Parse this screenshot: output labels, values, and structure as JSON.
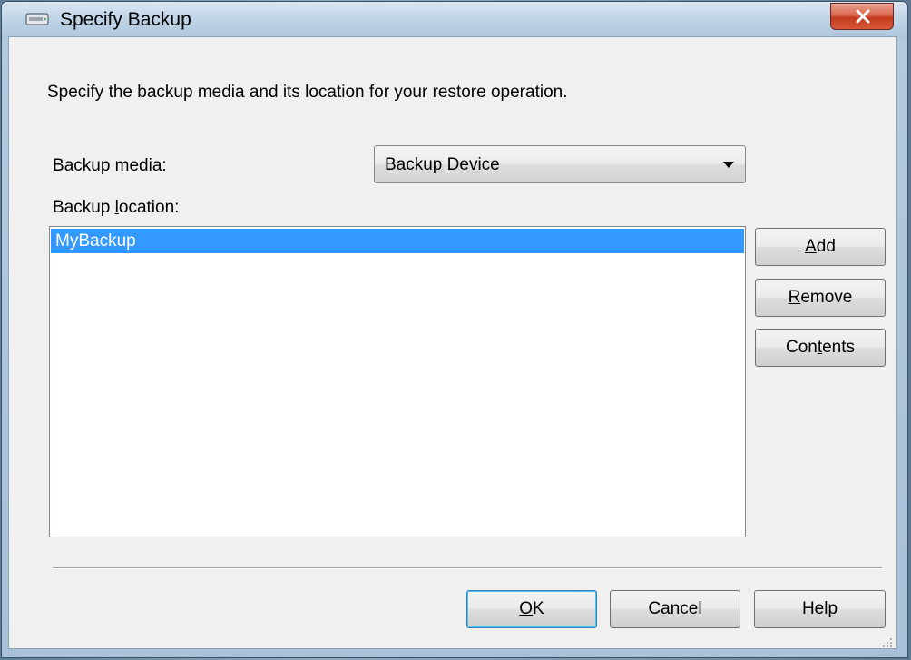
{
  "window": {
    "title": "Specify Backup",
    "icon": "backup-device-icon",
    "close_icon": "close-icon",
    "close_color": "#c43b1e"
  },
  "instruction": "Specify the backup media and its location for your restore operation.",
  "backup_media": {
    "label_accel": "B",
    "label_rest": "ackup media:",
    "selected_value": "Backup Device",
    "dropdown_icon": "chevron-down-icon"
  },
  "backup_location": {
    "label_before": "Backup ",
    "label_accel": "l",
    "label_after": "ocation:",
    "items": [
      "MyBackup"
    ],
    "selected_index": 0,
    "selection_color": "#3399ff"
  },
  "side_buttons": {
    "add": {
      "accel": "A",
      "rest": "dd"
    },
    "remove": {
      "accel": "R",
      "rest": "emove"
    },
    "contents": {
      "before": "Con",
      "accel": "t",
      "after": "ents"
    }
  },
  "footer_buttons": {
    "ok": {
      "accel": "O",
      "rest": "K"
    },
    "cancel": "Cancel",
    "help": "Help"
  }
}
